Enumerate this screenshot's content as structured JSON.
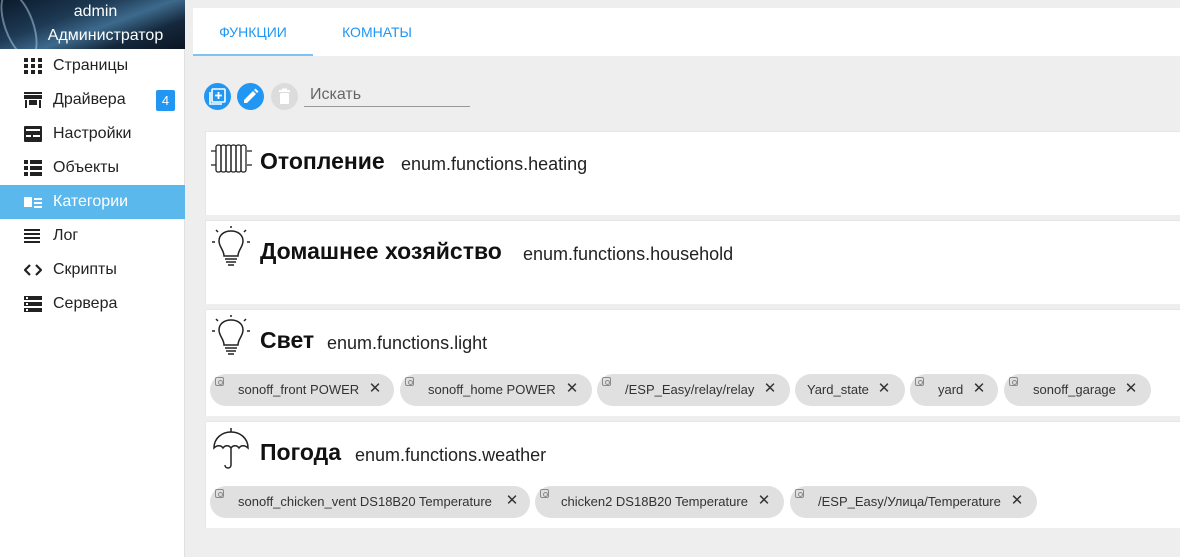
{
  "sidebar": {
    "user_name": "admin",
    "user_role": "Администратор",
    "items": [
      {
        "label": "Страницы",
        "icon": "grid-icon"
      },
      {
        "label": "Драйвера",
        "icon": "store-icon",
        "badge": "4"
      },
      {
        "label": "Настройки",
        "icon": "settings-card-icon"
      },
      {
        "label": "Объекты",
        "icon": "list-icon"
      },
      {
        "label": "Категории",
        "icon": "category-icon",
        "active": true
      },
      {
        "label": "Лог",
        "icon": "log-icon"
      },
      {
        "label": "Скрипты",
        "icon": "code-icon"
      },
      {
        "label": "Сервера",
        "icon": "server-icon"
      }
    ]
  },
  "tabs": [
    {
      "label": "Функции",
      "active": true
    },
    {
      "label": "Комнаты",
      "active": false
    }
  ],
  "toolbar": {
    "add_icon": "add-icon",
    "edit_icon": "edit-icon",
    "delete_icon": "delete-icon",
    "search_placeholder": "Искать"
  },
  "categories": [
    {
      "title": "Отопление",
      "id": "enum.functions.heating",
      "icon": "radiator-icon",
      "members": []
    },
    {
      "title": "Домашнее хозяйство",
      "id": "enum.functions.household",
      "icon": "lightbulb-icon",
      "members": []
    },
    {
      "title": "Свет",
      "id": "enum.functions.light",
      "icon": "lightbulb-icon",
      "members": [
        "sonoff_front POWER",
        "sonoff_home POWER",
        "/ESP_Easy/relay/relay",
        "Yard_state",
        "yard",
        "sonoff_garage"
      ]
    },
    {
      "title": "Погода",
      "id": "enum.functions.weather",
      "icon": "umbrella-icon",
      "members": [
        "sonoff_chicken_vent DS18B20 Temperature",
        "chicken2 DS18B20 Temperature",
        "/ESP_Easy/Улица/Temperature"
      ]
    }
  ],
  "colors": {
    "accent": "#2196f3",
    "active_menu": "#5bb8ec",
    "chip": "#e0e0e0"
  }
}
